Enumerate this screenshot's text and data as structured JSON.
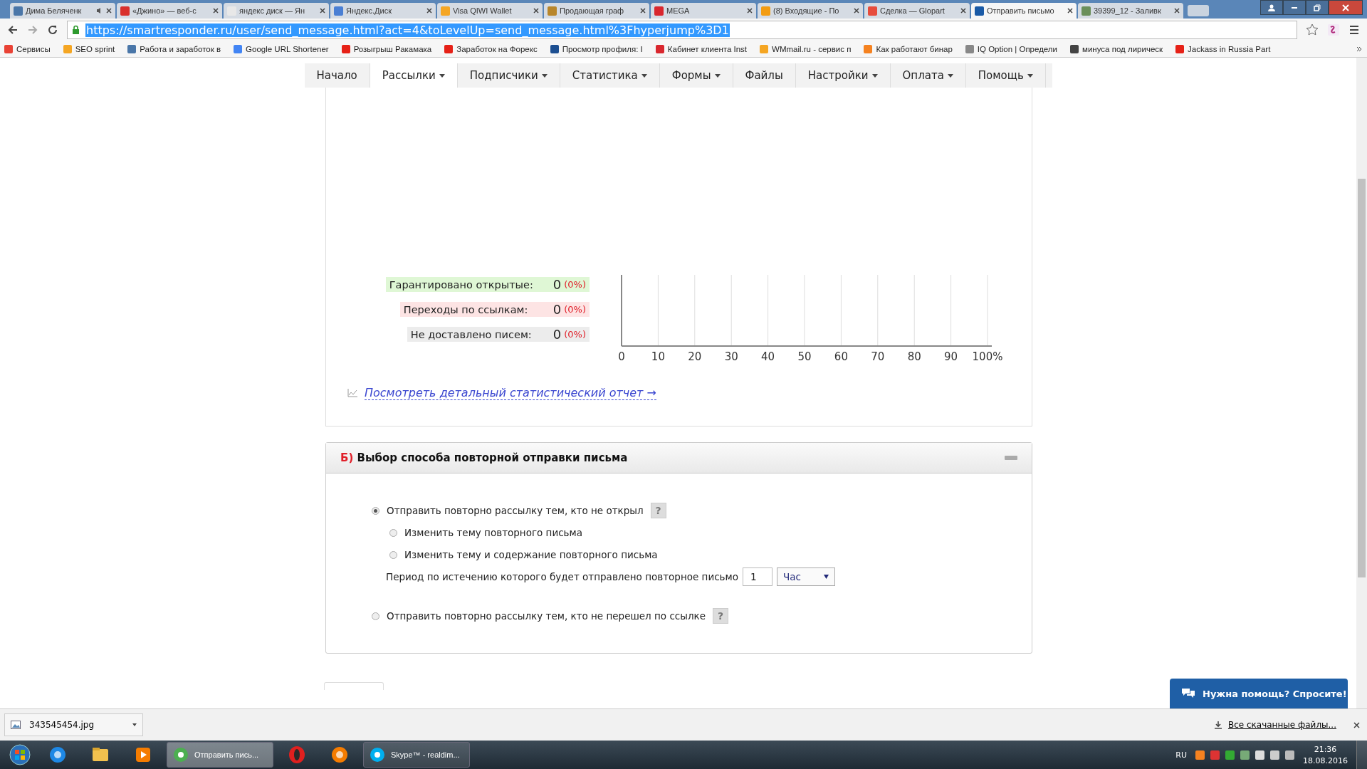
{
  "browser": {
    "tabs": [
      {
        "title": "Дима Беляченк",
        "selected": false,
        "audio": true,
        "color": "#4a76a8"
      },
      {
        "title": "«Джино» — веб-с",
        "selected": false,
        "audio": false,
        "color": "#d9302c"
      },
      {
        "title": "яндекс диск — Ян",
        "selected": false,
        "audio": false,
        "color": "#e8e8e8"
      },
      {
        "title": "Яндекс.Диск",
        "selected": false,
        "audio": false,
        "color": "#4a7fd4"
      },
      {
        "title": "Visa QIWI Wallet",
        "selected": false,
        "audio": false,
        "color": "#f5a623"
      },
      {
        "title": "Продающая граф",
        "selected": false,
        "audio": false,
        "color": "#b8862b"
      },
      {
        "title": "MEGA",
        "selected": false,
        "audio": false,
        "color": "#d9272e"
      },
      {
        "title": "(8) Входящие - По",
        "selected": false,
        "audio": false,
        "color": "#f39c12"
      },
      {
        "title": "Сделка — Glopart",
        "selected": false,
        "audio": false,
        "color": "#e74c3c"
      },
      {
        "title": "Отправить письмо",
        "selected": true,
        "audio": false,
        "color": "#1a5aa6"
      },
      {
        "title": "39399_12 - Заливк",
        "selected": false,
        "audio": false,
        "color": "#6a8f5a"
      }
    ],
    "url": "https://smartresponder.ru/user/send_message.html?act=4&toLevelUp=send_message.html%3Fhyperjump%3D1",
    "bookmarks": [
      {
        "label": "Сервисы",
        "color": "#e94235"
      },
      {
        "label": "SEO sprint",
        "color": "#f5a623"
      },
      {
        "label": "Работа и заработок в",
        "color": "#4a76a8"
      },
      {
        "label": "Google URL Shortener",
        "color": "#4285f4"
      },
      {
        "label": "Розыгрыш Ракамака",
        "color": "#e62117"
      },
      {
        "label": "Заработок на Форекс",
        "color": "#e62117"
      },
      {
        "label": "Просмотр профиля: I",
        "color": "#1d4f91"
      },
      {
        "label": "Кабинет клиента Inst",
        "color": "#d9272e"
      },
      {
        "label": "WMmail.ru - сервис п",
        "color": "#f5a623"
      },
      {
        "label": "Как работают бинар",
        "color": "#f58220"
      },
      {
        "label": "IQ Option | Определи",
        "color": "#888888"
      },
      {
        "label": "минуса под лирическ",
        "color": "#444444"
      },
      {
        "label": "Jackass in Russia Part",
        "color": "#e62117"
      }
    ]
  },
  "nav": [
    {
      "label": "Начало",
      "dropdown": false,
      "selected": false
    },
    {
      "label": "Рассылки",
      "dropdown": true,
      "selected": true
    },
    {
      "label": "Подписчики",
      "dropdown": true,
      "selected": false
    },
    {
      "label": "Статистика",
      "dropdown": true,
      "selected": false
    },
    {
      "label": "Формы",
      "dropdown": true,
      "selected": false
    },
    {
      "label": "Файлы",
      "dropdown": false,
      "selected": false
    },
    {
      "label": "Настройки",
      "dropdown": true,
      "selected": false
    },
    {
      "label": "Оплата",
      "dropdown": true,
      "selected": false
    },
    {
      "label": "Помощь",
      "dropdown": true,
      "selected": false
    }
  ],
  "stats": [
    {
      "kind": "opened",
      "label": "Гарантировано открытые:",
      "value": "0",
      "percent": "(0%)"
    },
    {
      "kind": "clicks",
      "label": "Переходы по ссылкам:",
      "value": "0",
      "percent": "(0%)"
    },
    {
      "kind": "undelivered",
      "label": "Не доставлено писем:",
      "value": "0",
      "percent": "(0%)"
    }
  ],
  "chart_data": {
    "type": "bar",
    "orientation": "horizontal",
    "values": [
      0,
      0,
      0
    ],
    "xlim": [
      0,
      100
    ],
    "grid": true,
    "xticks": [
      0,
      10,
      20,
      30,
      40,
      50,
      60,
      70,
      80,
      90,
      {
        "value": 100,
        "label": "100%"
      }
    ]
  },
  "report_link": "Посмотреть детальный статистический отчет →",
  "section_b": {
    "marker": "Б)",
    "title": "Выбор способа повторной отправки письма",
    "options": [
      {
        "label": "Отправить повторно рассылку тем, кто не открыл",
        "selected": true,
        "help": "?",
        "children": [
          {
            "label": "Изменить тему повторного письма",
            "selected": false
          },
          {
            "label": "Изменить тему и содержание повторного письма",
            "selected": false
          }
        ],
        "period": {
          "label": "Период по истечению которого будет отправлено повторное письмо",
          "value": "1",
          "unit": "Час"
        }
      },
      {
        "label": "Отправить повторно рассылку тем, кто не перешел по ссылке",
        "selected": false,
        "help": "?"
      }
    ]
  },
  "help_chat": "Нужна помощь? Спросите!",
  "downloads": {
    "file": "343545454.jpg",
    "all_link": "Все скачанные файлы..."
  },
  "taskbar": {
    "items": [
      {
        "kind": "ie"
      },
      {
        "kind": "explorer"
      },
      {
        "kind": "media"
      },
      {
        "kind": "chrome",
        "label": "Отправить пись...",
        "selected": true
      },
      {
        "kind": "opera"
      },
      {
        "kind": "firefox"
      },
      {
        "kind": "skype",
        "label": "Skype™ - realdim...",
        "selected": false
      }
    ],
    "language": "RU",
    "time": "21:36",
    "date": "18.08.2016"
  }
}
